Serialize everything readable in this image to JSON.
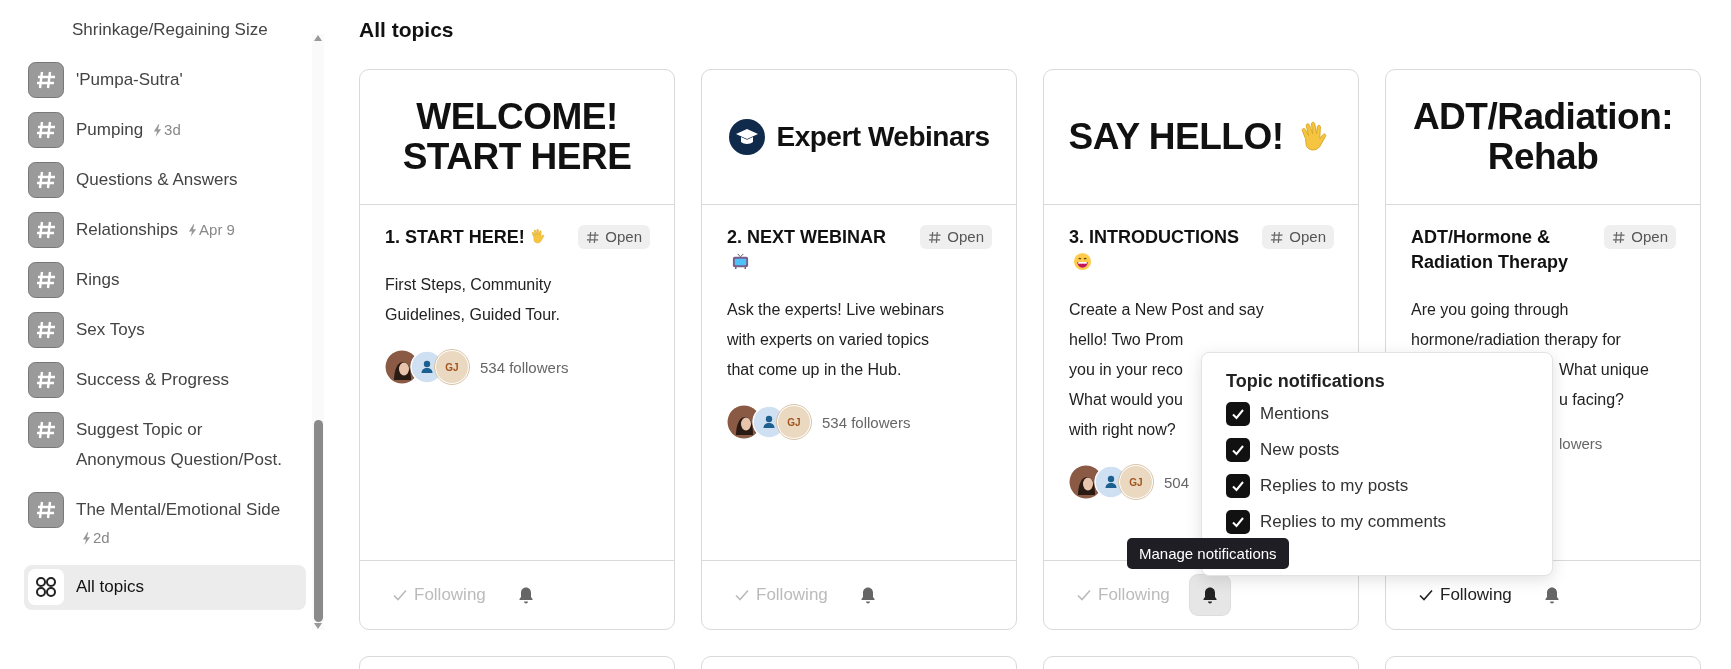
{
  "sidebar": {
    "items": [
      {
        "kind": "partial",
        "label": "Shrinkage/Regaining Size",
        "selected": false
      },
      {
        "kind": "topic",
        "label": "'Pumpa-Sutra'",
        "selected": false
      },
      {
        "kind": "topic",
        "label": "Pumping",
        "meta": "3d",
        "selected": false
      },
      {
        "kind": "topic",
        "label": "Questions & Answers",
        "selected": false
      },
      {
        "kind": "topic",
        "label": "Relationships",
        "meta": "Apr 9",
        "selected": false
      },
      {
        "kind": "topic",
        "label": "Rings",
        "selected": false
      },
      {
        "kind": "topic",
        "label": "Sex Toys",
        "selected": false
      },
      {
        "kind": "topic",
        "label": "Success & Progress",
        "selected": false
      },
      {
        "kind": "topic",
        "label": "Suggest Topic or Anonymous Question/Post.",
        "selected": false
      },
      {
        "kind": "topic",
        "label": "The Mental/Emotional Side",
        "meta": "2d",
        "meta_below": true,
        "selected": false
      },
      {
        "kind": "all",
        "label": "All topics",
        "selected": true
      }
    ]
  },
  "page_title": "All topics",
  "cards": [
    {
      "banner": {
        "kind": "text",
        "lines": [
          "WELCOME!",
          "START HERE"
        ]
      },
      "title": "1. START HERE!",
      "title_emoji": {
        "kind": "wave"
      },
      "badge": "Open",
      "description": [
        {
          "text": "First Steps, Community"
        },
        {
          "text": "Guidelines, Guided Tour."
        }
      ],
      "avatars": [
        {
          "kind": "photo"
        },
        {
          "kind": "person"
        },
        {
          "kind": "initials",
          "text": "GJ"
        }
      ],
      "followers": "534 followers",
      "following": {
        "label": "Following",
        "highlighted": false
      },
      "bell_pressed": false
    },
    {
      "banner": {
        "kind": "cap",
        "lines": [
          "Expert Webinars"
        ]
      },
      "title": "2. NEXT WEBINAR",
      "title_emoji": {
        "kind": "tv"
      },
      "badge": "Open",
      "description": [
        {
          "text": "Ask the experts! Live webinars"
        },
        {
          "text": "with experts on varied topics"
        },
        {
          "text": "that come up in the Hub."
        }
      ],
      "avatars": [
        {
          "kind": "photo"
        },
        {
          "kind": "person"
        },
        {
          "kind": "initials",
          "text": "GJ"
        }
      ],
      "followers": "534 followers",
      "following": {
        "label": "Following",
        "highlighted": false
      },
      "bell_pressed": false
    },
    {
      "banner": {
        "kind": "wave",
        "lines": [
          "SAY HELLO!"
        ]
      },
      "title": "3. INTRODUCTIONS",
      "title_emoji": {
        "kind": "smile"
      },
      "badge": "Open",
      "description": [
        {
          "text": "Create a New Post and say"
        },
        {
          "text": "hello! Two Prom"
        },
        {
          "text": "you in your reco"
        },
        {
          "text": "What would you"
        },
        {
          "text": "with right now?"
        }
      ],
      "avatars": [
        {
          "kind": "photo"
        },
        {
          "kind": "person"
        },
        {
          "kind": "initials",
          "text": "GJ"
        }
      ],
      "followers": "504",
      "following": {
        "label": "Following",
        "highlighted": false
      },
      "bell_pressed": true
    },
    {
      "banner": {
        "kind": "text",
        "lines": [
          "ADT/Radiation:",
          "Rehab"
        ]
      },
      "title": "ADT/Hormone & Radiation Therapy",
      "badge": "Open",
      "description": [
        {
          "text": "Are you going through"
        },
        {
          "text": "hormone/radiation therapy for"
        },
        {
          "text": "What unique",
          "covered": true
        },
        {
          "text": "u facing?",
          "covered": true
        }
      ],
      "followers": "lowers",
      "followers_covered": true,
      "following": {
        "label": "Following",
        "highlighted": true
      },
      "bell_pressed": false
    }
  ],
  "next_row": [
    {
      "kind": "card"
    },
    {
      "kind": "card"
    },
    {
      "kind": "card"
    },
    {
      "kind": "card"
    }
  ],
  "notifications_menu": {
    "title": "Topic notifications",
    "options": [
      {
        "label": "Mentions",
        "checked": true
      },
      {
        "label": "New posts",
        "checked": true
      },
      {
        "label": "Replies to my posts",
        "checked": true
      },
      {
        "label": "Replies to my comments",
        "checked": true
      }
    ]
  },
  "tooltip": {
    "text": "Manage notifications"
  }
}
